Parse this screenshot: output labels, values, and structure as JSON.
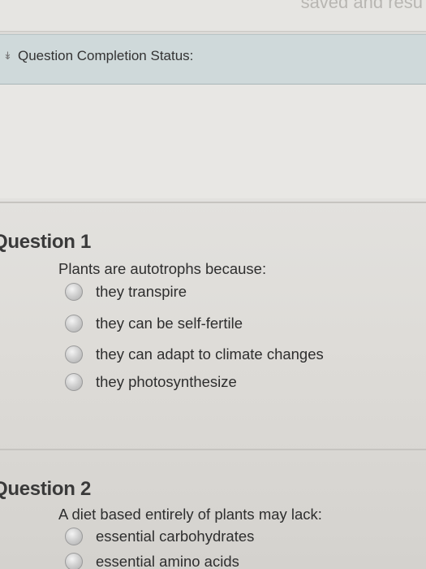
{
  "header": {
    "banner_partial_text": "saved and resu",
    "completion_status_label": "Question Completion Status:"
  },
  "questions": [
    {
      "title": "Question 1",
      "prompt": "Plants are autotrophs because:",
      "options": [
        "they transpire",
        "they can be self-fertile",
        "they can adapt to climate changes",
        "they photosynthesize"
      ]
    },
    {
      "title": "Question 2",
      "prompt": "A diet based entirely of plants may lack:",
      "options": [
        "essential carbohydrates",
        "essential amino acids"
      ]
    }
  ],
  "icons": {
    "completion_status_toggle": "double-chevron-down-icon",
    "option_marker": "radio-button-icon"
  }
}
